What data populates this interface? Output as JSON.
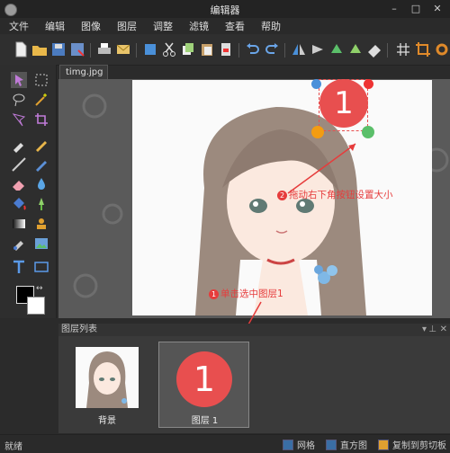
{
  "window": {
    "title": "编辑器",
    "minimize": "–",
    "maximize": "□",
    "close": "✕"
  },
  "menu": [
    "文件",
    "编辑",
    "图像",
    "图层",
    "调整",
    "滤镜",
    "查看",
    "帮助"
  ],
  "document_tab": "timg.jpg *",
  "layer_overlay": {
    "number": "1"
  },
  "annotations": {
    "step1": {
      "badge": "1",
      "text": "单击选中图层1"
    },
    "step2": {
      "badge": "2",
      "text": "拖动右下角按钮设置大小"
    }
  },
  "layers_panel": {
    "title": "图层列表",
    "layers": [
      {
        "name": "背景"
      },
      {
        "name": "图层 1",
        "number": "1"
      }
    ]
  },
  "statusbar": {
    "left": "就绪",
    "grid": "网格",
    "histogram": "直方图",
    "copy_to_clipboard": "复制到剪切板"
  },
  "colors": {
    "accent_red": "#e84f4f",
    "annotation_red": "#e63c3c",
    "dark_bg": "#2b2b2b"
  }
}
